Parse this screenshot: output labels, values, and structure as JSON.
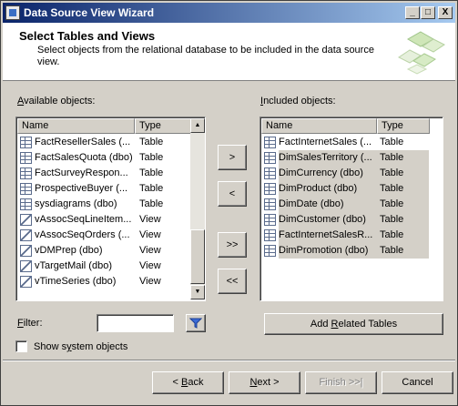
{
  "window": {
    "title": "Data Source View Wizard",
    "controls": [
      "_",
      "□",
      "X"
    ]
  },
  "header": {
    "title": "Select Tables and Views",
    "subtitle": "Select objects from the relational database to be included in the data source view."
  },
  "available": {
    "label_prefix": "A",
    "label_rest": "vailable objects:",
    "col_name": "Name",
    "col_type": "Type",
    "items": [
      {
        "name": "FactResellerSales (...",
        "type": "Table",
        "icon": "table-icon"
      },
      {
        "name": "FactSalesQuota (dbo)",
        "type": "Table",
        "icon": "table-icon"
      },
      {
        "name": "FactSurveyRespon...",
        "type": "Table",
        "icon": "table-icon"
      },
      {
        "name": "ProspectiveBuyer (...",
        "type": "Table",
        "icon": "table-icon"
      },
      {
        "name": "sysdiagrams (dbo)",
        "type": "Table",
        "icon": "table-icon"
      },
      {
        "name": "vAssocSeqLineItem...",
        "type": "View",
        "icon": "view-icon"
      },
      {
        "name": "vAssocSeqOrders (...",
        "type": "View",
        "icon": "view-icon"
      },
      {
        "name": "vDMPrep (dbo)",
        "type": "View",
        "icon": "view-icon"
      },
      {
        "name": "vTargetMail (dbo)",
        "type": "View",
        "icon": "view-icon"
      },
      {
        "name": "vTimeSeries (dbo)",
        "type": "View",
        "icon": "view-icon"
      }
    ]
  },
  "included": {
    "label_prefix": "I",
    "label_rest": "ncluded objects:",
    "col_name": "Name",
    "col_type": "Type",
    "items": [
      {
        "name": "FactInternetSales (...",
        "type": "Table",
        "selected": false
      },
      {
        "name": "DimSalesTerritory (...",
        "type": "Table",
        "selected": true
      },
      {
        "name": "DimCurrency (dbo)",
        "type": "Table",
        "selected": true
      },
      {
        "name": "DimProduct (dbo)",
        "type": "Table",
        "selected": true
      },
      {
        "name": "DimDate (dbo)",
        "type": "Table",
        "selected": true
      },
      {
        "name": "DimCustomer (dbo)",
        "type": "Table",
        "selected": true
      },
      {
        "name": "FactInternetSalesR...",
        "type": "Table",
        "selected": true
      },
      {
        "name": "DimPromotion (dbo)",
        "type": "Table",
        "selected": true
      }
    ]
  },
  "move_buttons": {
    "add": ">",
    "remove": "<",
    "add_all": ">>",
    "remove_all": "<<"
  },
  "filter": {
    "label_prefix": "F",
    "label_rest": "ilter:",
    "value": ""
  },
  "show_system": {
    "label_prefix": "Show s",
    "label_accel": "y",
    "label_rest": "stem objects",
    "checked": false
  },
  "add_related": {
    "label_prefix": "Add ",
    "label_accel": "R",
    "label_rest": "elated Tables"
  },
  "footer": {
    "back_prefix": "< ",
    "back_accel": "B",
    "back_rest": "ack",
    "next_accel": "N",
    "next_rest": "ext >",
    "finish": "Finish >>|",
    "cancel": "Cancel"
  }
}
